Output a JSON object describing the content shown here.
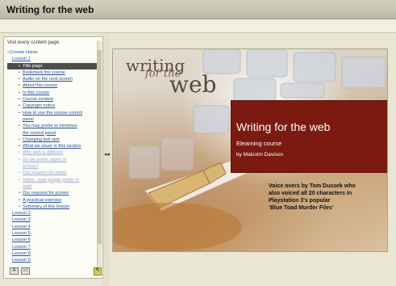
{
  "window": {
    "title": "Writing for the web"
  },
  "sidebar": {
    "intro": "Visit every content page.",
    "course_home": "Course Home",
    "lesson1": {
      "label": "Lesson 1",
      "items": [
        {
          "label": "Title page",
          "active": true
        },
        {
          "label": "Bookmark the course"
        },
        {
          "label": "Audio on the next screen"
        },
        {
          "label": "About this course"
        },
        {
          "label": "In this course"
        },
        {
          "label": "Course content"
        },
        {
          "label": "Copyright notice"
        },
        {
          "label": "How to use the course control"
        },
        {
          "label": "panel",
          "continuation": true
        },
        {
          "label": "You may prefer to minimise"
        },
        {
          "label": "the control panel",
          "continuation": true
        },
        {
          "label": "Changing text size"
        },
        {
          "label": "What we cover in this section"
        },
        {
          "label": "Why web is different",
          "blurred": true
        },
        {
          "label": "Do we prefer paper or",
          "blurred": true
        },
        {
          "label": "screen?",
          "continuation": true,
          "blurred": true
        },
        {
          "label": "Our reasons for paper",
          "blurred": true
        },
        {
          "label": "Video - how people prefer to",
          "blurred": true
        },
        {
          "label": "read",
          "continuation": true,
          "blurred": true
        },
        {
          "label": "Our reasons for screen"
        },
        {
          "label": "A practical exercise"
        },
        {
          "label": "Summary of this lesson"
        }
      ]
    },
    "lessons": [
      "Lesson 2",
      "Lesson 3",
      "Lesson 4",
      "Lesson 5",
      "Lesson 6",
      "Lesson 7",
      "Lesson 8",
      "Lesson 9"
    ],
    "bullet": "•",
    "collapse_arrow": "◂◂",
    "buttons": {
      "a": "A",
      "b": "▭",
      "note": "✎"
    }
  },
  "slide": {
    "logo_line1": "writing",
    "logo_line2": "for the",
    "logo_line3": "web",
    "title": "Writing for the web",
    "subtitle": "Elearning course",
    "author": "by Malcolm Davison",
    "voiceover": [
      "Voice overs by Tom Dussek who",
      "also voiced all 20 characters in",
      "Playstation 3's popular",
      "‘Blue Toad Murder Files’"
    ],
    "accent_color": "#7a1a10"
  }
}
